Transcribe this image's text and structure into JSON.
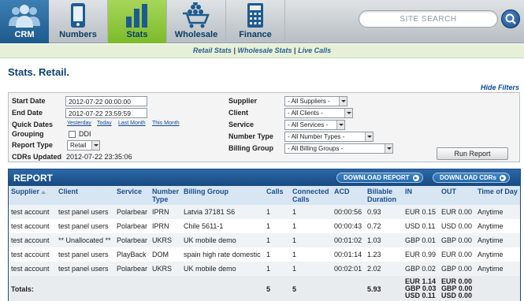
{
  "nav": {
    "tabs": [
      {
        "label": "CRM",
        "icon": "users-icon"
      },
      {
        "label": "Numbers",
        "icon": "phone-icon"
      },
      {
        "label": "Stats",
        "icon": "bar-chart-icon",
        "active": true
      },
      {
        "label": "Wholesale",
        "icon": "cart-icon"
      },
      {
        "label": "Finance",
        "icon": "calculator-icon"
      }
    ],
    "search_placeholder": "SITE SEARCH"
  },
  "subnav": {
    "links": [
      "Retail Stats",
      "Wholesale Stats",
      "Live Calls"
    ],
    "separator": "|"
  },
  "page": {
    "title": "Stats. Retail.",
    "hide_filters": "Hide Filters"
  },
  "filters": {
    "start_date_label": "Start Date",
    "start_date_value": "2012-07-22 00:00:00",
    "end_date_label": "End Date",
    "end_date_value": "2012-07-22 23:59:59",
    "quick_dates_label": "Quick Dates",
    "quick_dates": [
      "Yesterday",
      "Today",
      "Last Month",
      "This Month"
    ],
    "grouping_label": "Grouping",
    "ddi_label": "DDI",
    "report_type_label": "Report Type",
    "report_type_value": "Retail",
    "cdrs_updated_label": "CDRs Updated",
    "cdrs_updated_value": "2012-07-22 23:35:06",
    "supplier_label": "Supplier",
    "supplier_value": "- All Suppliers -",
    "client_label": "Client",
    "client_value": "- All Clients -",
    "service_label": "Service",
    "service_value": "- All Services -",
    "number_type_label": "Number Type",
    "number_type_value": "- All Number Types -",
    "billing_group_label": "Billing Group",
    "billing_group_value": "- All Billing Groups -",
    "run_report": "Run Report"
  },
  "report": {
    "title": "REPORT",
    "download_report": "DOWNLOAD REPORT",
    "download_cdrs": "DOWNLOAD CDRs",
    "columns": [
      "Supplier",
      "Client",
      "Service",
      "Number Type",
      "Billing Group",
      "Calls",
      "Connected Calls",
      "ACD",
      "Billable Duration",
      "IN",
      "OUT",
      "Time of Day"
    ],
    "rows": [
      [
        "test account",
        "test panel users",
        "Polarbear",
        "IPRN",
        "Latvia 37181 S6",
        "1",
        "1",
        "00:00:56",
        "0.93",
        "EUR 0.15",
        "EUR 0.00",
        "Anytime"
      ],
      [
        "test account",
        "test panel users",
        "Polarbear",
        "IPRN",
        "Chile 5611-1",
        "1",
        "1",
        "00:00:43",
        "0.72",
        "USD 0.11",
        "USD 0.00",
        "Anytime"
      ],
      [
        "test account",
        "** Unallocated **",
        "Polarbear",
        "UKRS",
        "UK mobile demo",
        "1",
        "1",
        "00:01:02",
        "1.03",
        "GBP 0.01",
        "GBP 0.00",
        "Anytime"
      ],
      [
        "test account",
        "test panel users",
        "PlayBack",
        "DOM",
        "spain high rate domestic",
        "1",
        "1",
        "00:01:14",
        "1.23",
        "EUR 0.99",
        "EUR 0.00",
        "Anytime"
      ],
      [
        "test account",
        "test panel users",
        "Polarbear",
        "UKRS",
        "UK mobile demo",
        "1",
        "1",
        "00:02:01",
        "2.02",
        "GBP 0.02",
        "GBP 0.00",
        "Anytime"
      ]
    ],
    "totals": {
      "label": "Totals:",
      "calls": "5",
      "connected": "5",
      "billable": "5.93",
      "in": [
        "EUR 1.14",
        "GBP 0.03",
        "USD 0.11"
      ],
      "out": [
        "EUR 0.00",
        "GBP 0.00",
        "USD 0.00"
      ]
    }
  },
  "colors": {
    "nav_active": "#8cc63f",
    "brand_blue": "#1d5a8c",
    "report_header": "#2160a0"
  }
}
